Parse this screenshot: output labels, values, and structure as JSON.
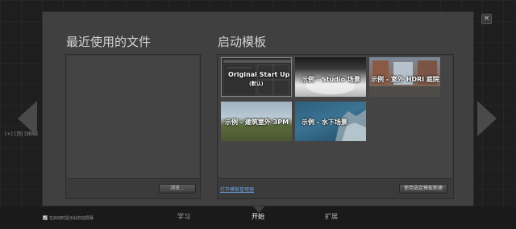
{
  "viewport": {
    "label": "[+] [顶] [线框]"
  },
  "dialog": {
    "recent": {
      "title": "最近使用的文件",
      "browse_label": "浏览..."
    },
    "templates": {
      "title": "启动模板",
      "items": [
        {
          "name": "Original Start Up",
          "sub": "(默认)"
        },
        {
          "name": "示例 - Studio 场景"
        },
        {
          "name": "示例 - 室外 HDRI 庭院"
        },
        {
          "name": "示例 - 建筑室外 3PM"
        },
        {
          "name": "示例 - 水下场景"
        }
      ],
      "open_manager_label": "打开模板管理器",
      "create_label": "使用选定模板新建"
    },
    "close_label": "×"
  },
  "bottom": {
    "show_on_startup_label": "在启动时显示此欢迎屏幕",
    "tabs": [
      {
        "label": "学习"
      },
      {
        "label": "开始"
      },
      {
        "label": "扩展"
      }
    ]
  }
}
